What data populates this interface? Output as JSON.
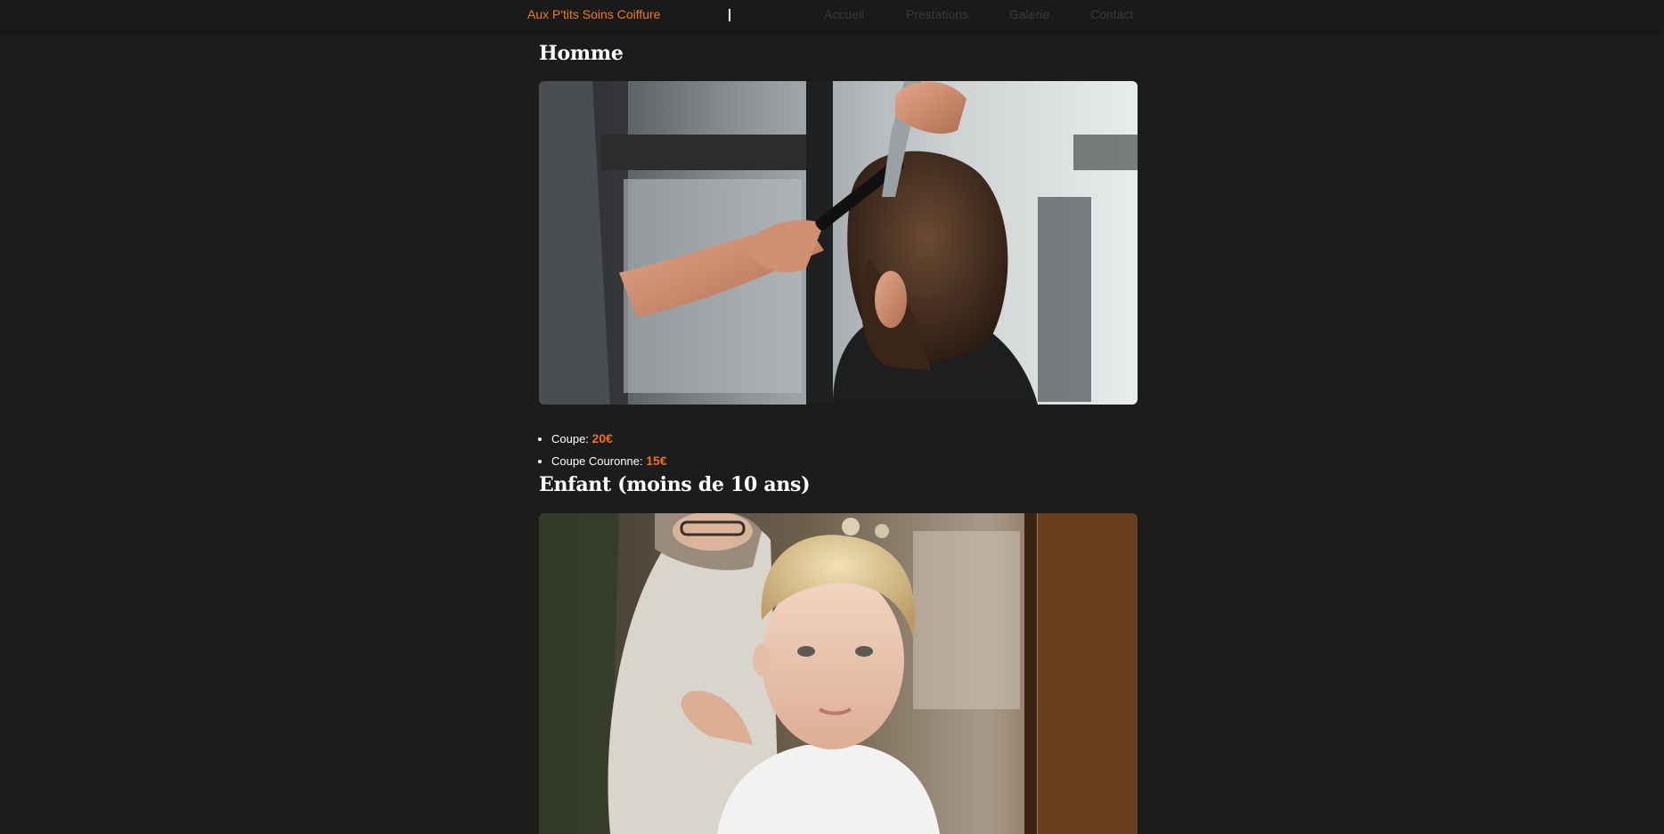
{
  "nav": {
    "brand": "Aux P'tits Soins Coiffure",
    "links": [
      "Accueil",
      "Prestations",
      "Galerie",
      "Contact"
    ]
  },
  "sections": [
    {
      "title": "Homme",
      "image_alt": "Coiffeur coupant les cheveux d'un homme",
      "items": [
        {
          "label": "Coupe:",
          "price": "20€"
        },
        {
          "label": "Coupe Couronne:",
          "price": "15€"
        }
      ]
    },
    {
      "title": "Enfant (moins de 10 ans)",
      "image_alt": "Jeune garçon blond chez le coiffeur"
    }
  ],
  "colors": {
    "accent": "#f07a1a",
    "background": "#1c1c1c",
    "navbar": "#1a1a1a",
    "nav_link": "#3a3a3a"
  }
}
